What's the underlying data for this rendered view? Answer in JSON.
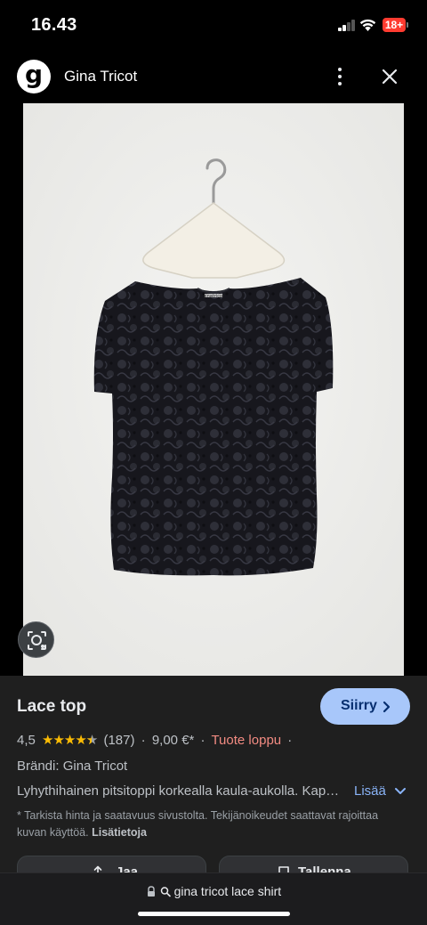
{
  "status_bar": {
    "time": "16.43",
    "battery": "18+"
  },
  "header": {
    "logo_letter": "g",
    "site_name": "Gina Tricot"
  },
  "image": {
    "tag_text": "ginatricot",
    "alt": "Lace top"
  },
  "product": {
    "title": "Lace top",
    "visit_label": "Siirry",
    "rating": "4,5",
    "stars": "★★★★",
    "star_half": "★",
    "review_count": "(187)",
    "sep1": "·",
    "price": "9,00 €*",
    "sep2": "·",
    "stock": "Tuote loppu",
    "sep3": "·",
    "brand": "Brändi: Gina Tricot",
    "description": "Lyhythihainen pitsitoppi korkealla kaula-aukolla. Kapea malli.",
    "more_label": "Lisää",
    "disclaimer": "* Tarkista hinta ja saatavuus sivustolta. Tekijänoikeudet saattavat rajoittaa kuvan käyttöä.",
    "disclaimer_link": "Lisätietoja"
  },
  "actions": {
    "share_label": "Jaa",
    "save_label": "Tallenna"
  },
  "url_bar": {
    "url": "gina tricot lace shirt"
  },
  "colors": {
    "accent": "#a8c7fa",
    "star": "#fbbc04",
    "stock": "#f28b82",
    "link": "#8ab4f8"
  }
}
